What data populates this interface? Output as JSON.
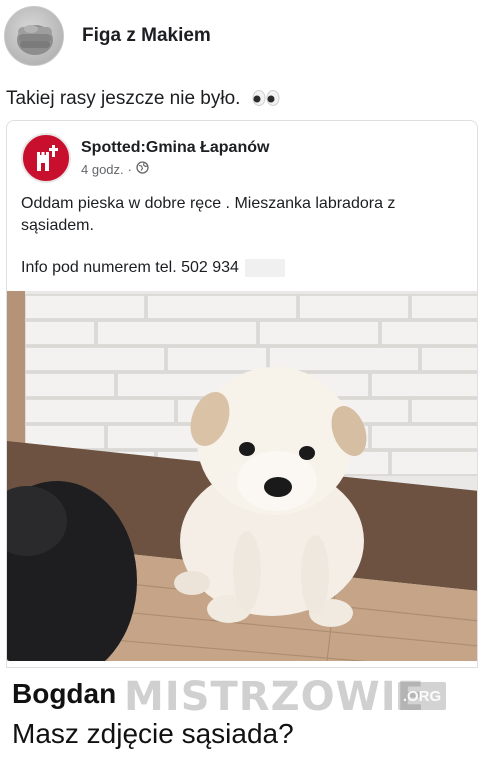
{
  "outer_post": {
    "author": "Figa z Makiem",
    "text": "Takiej rasy jeszcze nie było.",
    "emoji_icon": "eyes-icon"
  },
  "shared_post": {
    "page_name": "Spotted:Gmina Łapanów",
    "time": "4 godz.",
    "separator": "·",
    "privacy_icon": "globe-icon",
    "body": "Oddam pieska w dobre ręce . Mieszanka labradora z sąsiadem.",
    "info": "Info pod numerem tel. 502 934"
  },
  "comment": {
    "author": "Bogdan",
    "text": "Masz zdjęcie sąsiada?"
  },
  "watermark": {
    "text": "MISTRZOWIE",
    "suffix": ".ORG"
  },
  "colors": {
    "page_avatar_red": "#c8102e",
    "meta_gray": "#65676b"
  }
}
